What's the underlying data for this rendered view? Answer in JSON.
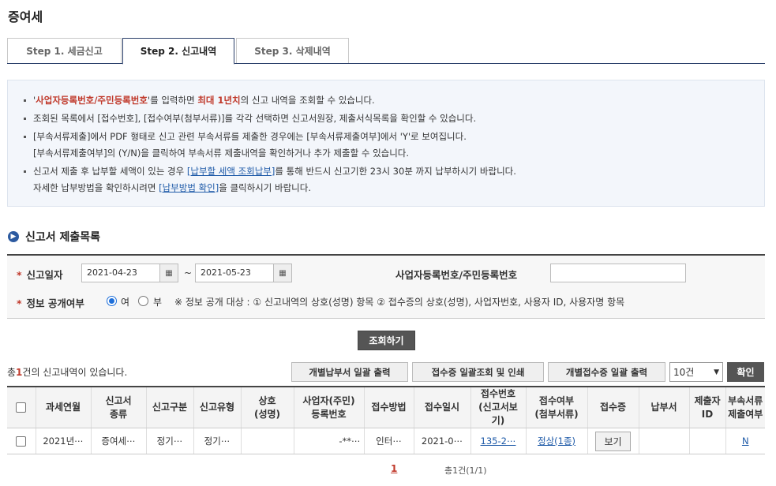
{
  "page_title": "증여세",
  "tabs": [
    {
      "label": "Step 1. 세금신고"
    },
    {
      "label": "Step 2. 신고내역"
    },
    {
      "label": "Step 3. 삭제내역"
    }
  ],
  "notice": {
    "l1_quote_open": "'",
    "l1_red": "사업자등록번호/주민등록번호",
    "l1_quote_close": "'",
    "l1_mid": "를 입력하면 ",
    "l1_bold": "최대 1년치",
    "l1_end": "의 신고 내역을 조회할 수 있습니다.",
    "l2": "조회된 목록에서 [접수번호], [접수여부(첨부서류)]를 각각 선택하면 신고서원장, 제출서식목록을 확인할 수 있습니다.",
    "l3a": "[부속서류제출]에서 PDF 형태로 신고 관련 부속서류를 제출한 경우에는 [부속서류제출여부]에서 'Y'로 보여집니다.",
    "l3b": "[부속서류제출여부]의 (Y/N)을 클릭하여 부속서류 제출내역을 확인하거나 추가 제출할 수 있습니다.",
    "l4a_pre": "신고서 제출 후 납부할 세액이 있는 경우 ",
    "l4a_link": "[납부할 세액 조회납부]",
    "l4a_post": "를 통해 반드시 신고기한 23시 30분 까지 납부하시기 바랍니다.",
    "l4b_pre": "자세한 납부방법을 확인하시려면 ",
    "l4b_link": "[납부방법 확인]",
    "l4b_post": "을 클릭하시기 바랍니다."
  },
  "section_title": "신고서 제출목록",
  "search": {
    "date_label": "신고일자",
    "date_from": "2021-04-23",
    "date_to": "2021-05-23",
    "tilde": "~",
    "id_label": "사업자등록번호/주민등록번호",
    "id_value": "",
    "disclosure_label": "정보 공개여부",
    "yes_label": "여",
    "no_label": "부",
    "note": "※ 정보 공개 대상 : ① 신고내역의 상호(성명) 항목 ② 접수증의 상호(성명), 사업자번호, 사용자 ID, 사용자명 항목",
    "required_mark": "*"
  },
  "search_button": "조회하기",
  "result": {
    "count_pre": "총",
    "count_num": "1",
    "count_post": "건의 신고내역이 있습니다.",
    "btn_bulk_payment": "개별납부서 일괄 출력",
    "btn_bulk_receipt": "접수증 일괄조회 및 인쇄",
    "btn_individual_receipt": "개별접수증 일괄 출력",
    "page_size": "10건",
    "confirm": "확인"
  },
  "table": {
    "headers": [
      "",
      "과세연월",
      "신고서\n종류",
      "신고구분",
      "신고유형",
      "상호\n(성명)",
      "사업자(주민)\n등록번호",
      "접수방법",
      "접수일시",
      "접수번호\n(신고서보기)",
      "접수여부\n(첨부서류)",
      "접수증",
      "납부서",
      "제출자\nID",
      "부속서류\n제출여부"
    ],
    "rows": [
      {
        "period": "2021년⋯",
        "form": "증여세⋯",
        "category": "정기⋯",
        "type": "정기⋯",
        "name": "",
        "reg_no": "-**⋯",
        "method": "인터⋯",
        "datetime": "2021-0⋯",
        "receipt_no": "135-2⋯",
        "status": "정상(1종)",
        "receipt_btn": "보기",
        "payment": "",
        "submitter": "",
        "attached": "N"
      }
    ]
  },
  "pagination": {
    "current": "1",
    "total": "총1건(1/1)"
  }
}
